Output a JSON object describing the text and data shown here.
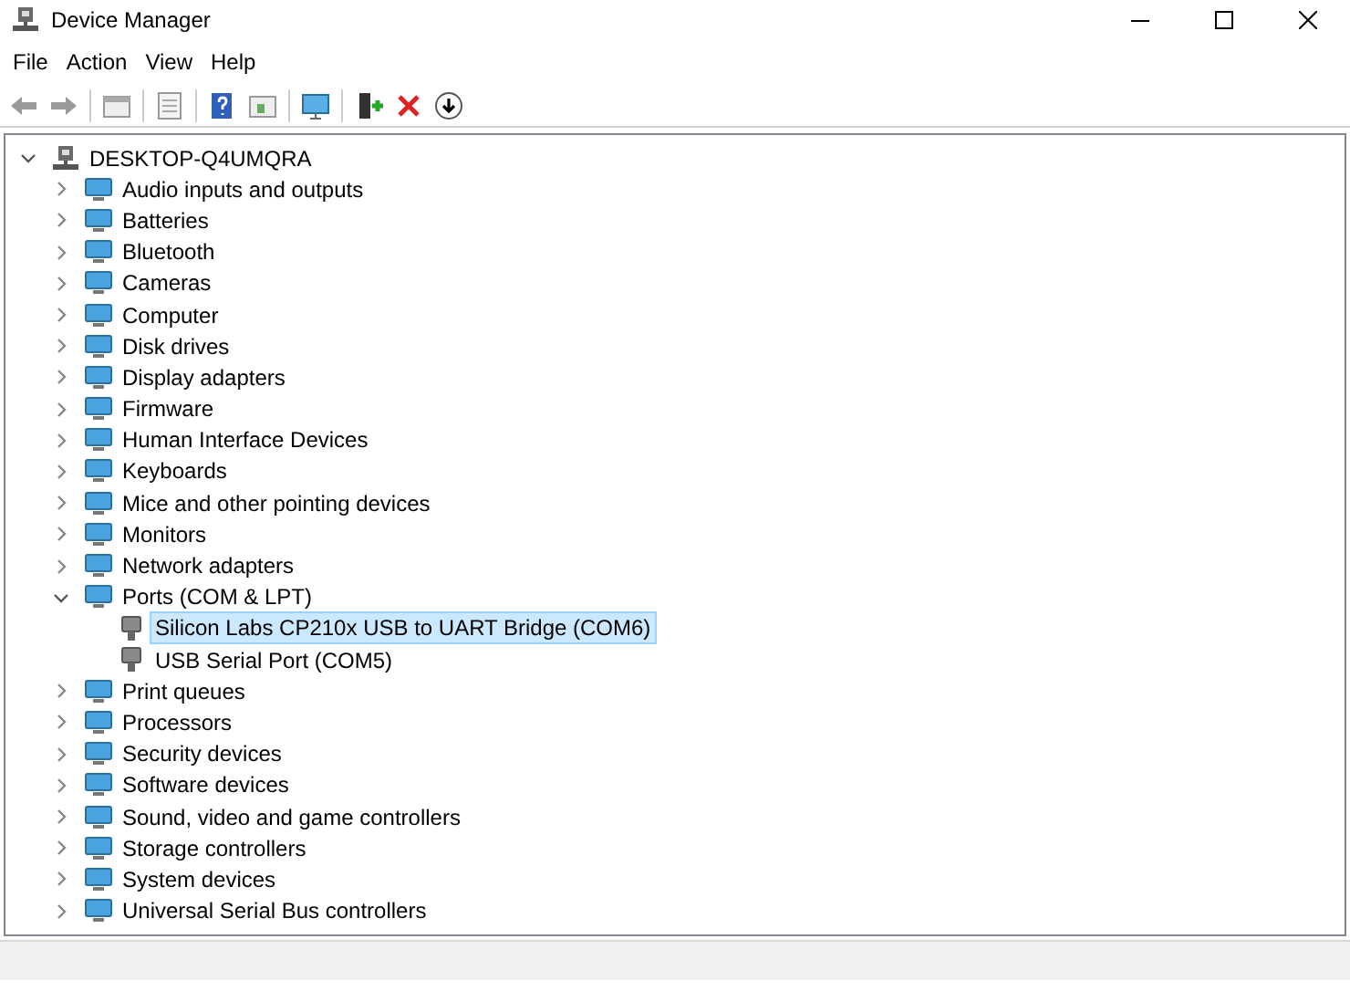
{
  "window": {
    "title": "Device Manager"
  },
  "menu": [
    "File",
    "Action",
    "View",
    "Help"
  ],
  "tree": {
    "label": "DESKTOP-Q4UMQRA",
    "expanded": true,
    "children": [
      {
        "label": "Audio inputs and outputs",
        "expanded": false
      },
      {
        "label": "Batteries",
        "expanded": false
      },
      {
        "label": "Bluetooth",
        "expanded": false
      },
      {
        "label": "Cameras",
        "expanded": false
      },
      {
        "label": "Computer",
        "expanded": false
      },
      {
        "label": "Disk drives",
        "expanded": false
      },
      {
        "label": "Display adapters",
        "expanded": false
      },
      {
        "label": "Firmware",
        "expanded": false
      },
      {
        "label": "Human Interface Devices",
        "expanded": false
      },
      {
        "label": "Keyboards",
        "expanded": false
      },
      {
        "label": "Mice and other pointing devices",
        "expanded": false
      },
      {
        "label": "Monitors",
        "expanded": false
      },
      {
        "label": "Network adapters",
        "expanded": false
      },
      {
        "label": "Ports (COM & LPT)",
        "expanded": true,
        "children": [
          {
            "label": "Silicon Labs CP210x USB to UART Bridge (COM6)",
            "selected": true
          },
          {
            "label": "USB Serial Port (COM5)",
            "selected": false
          }
        ]
      },
      {
        "label": "Print queues",
        "expanded": false
      },
      {
        "label": "Processors",
        "expanded": false
      },
      {
        "label": "Security devices",
        "expanded": false
      },
      {
        "label": "Software devices",
        "expanded": false
      },
      {
        "label": "Sound, video and game controllers",
        "expanded": false
      },
      {
        "label": "Storage controllers",
        "expanded": false
      },
      {
        "label": "System devices",
        "expanded": false
      },
      {
        "label": "Universal Serial Bus controllers",
        "expanded": false
      }
    ]
  }
}
